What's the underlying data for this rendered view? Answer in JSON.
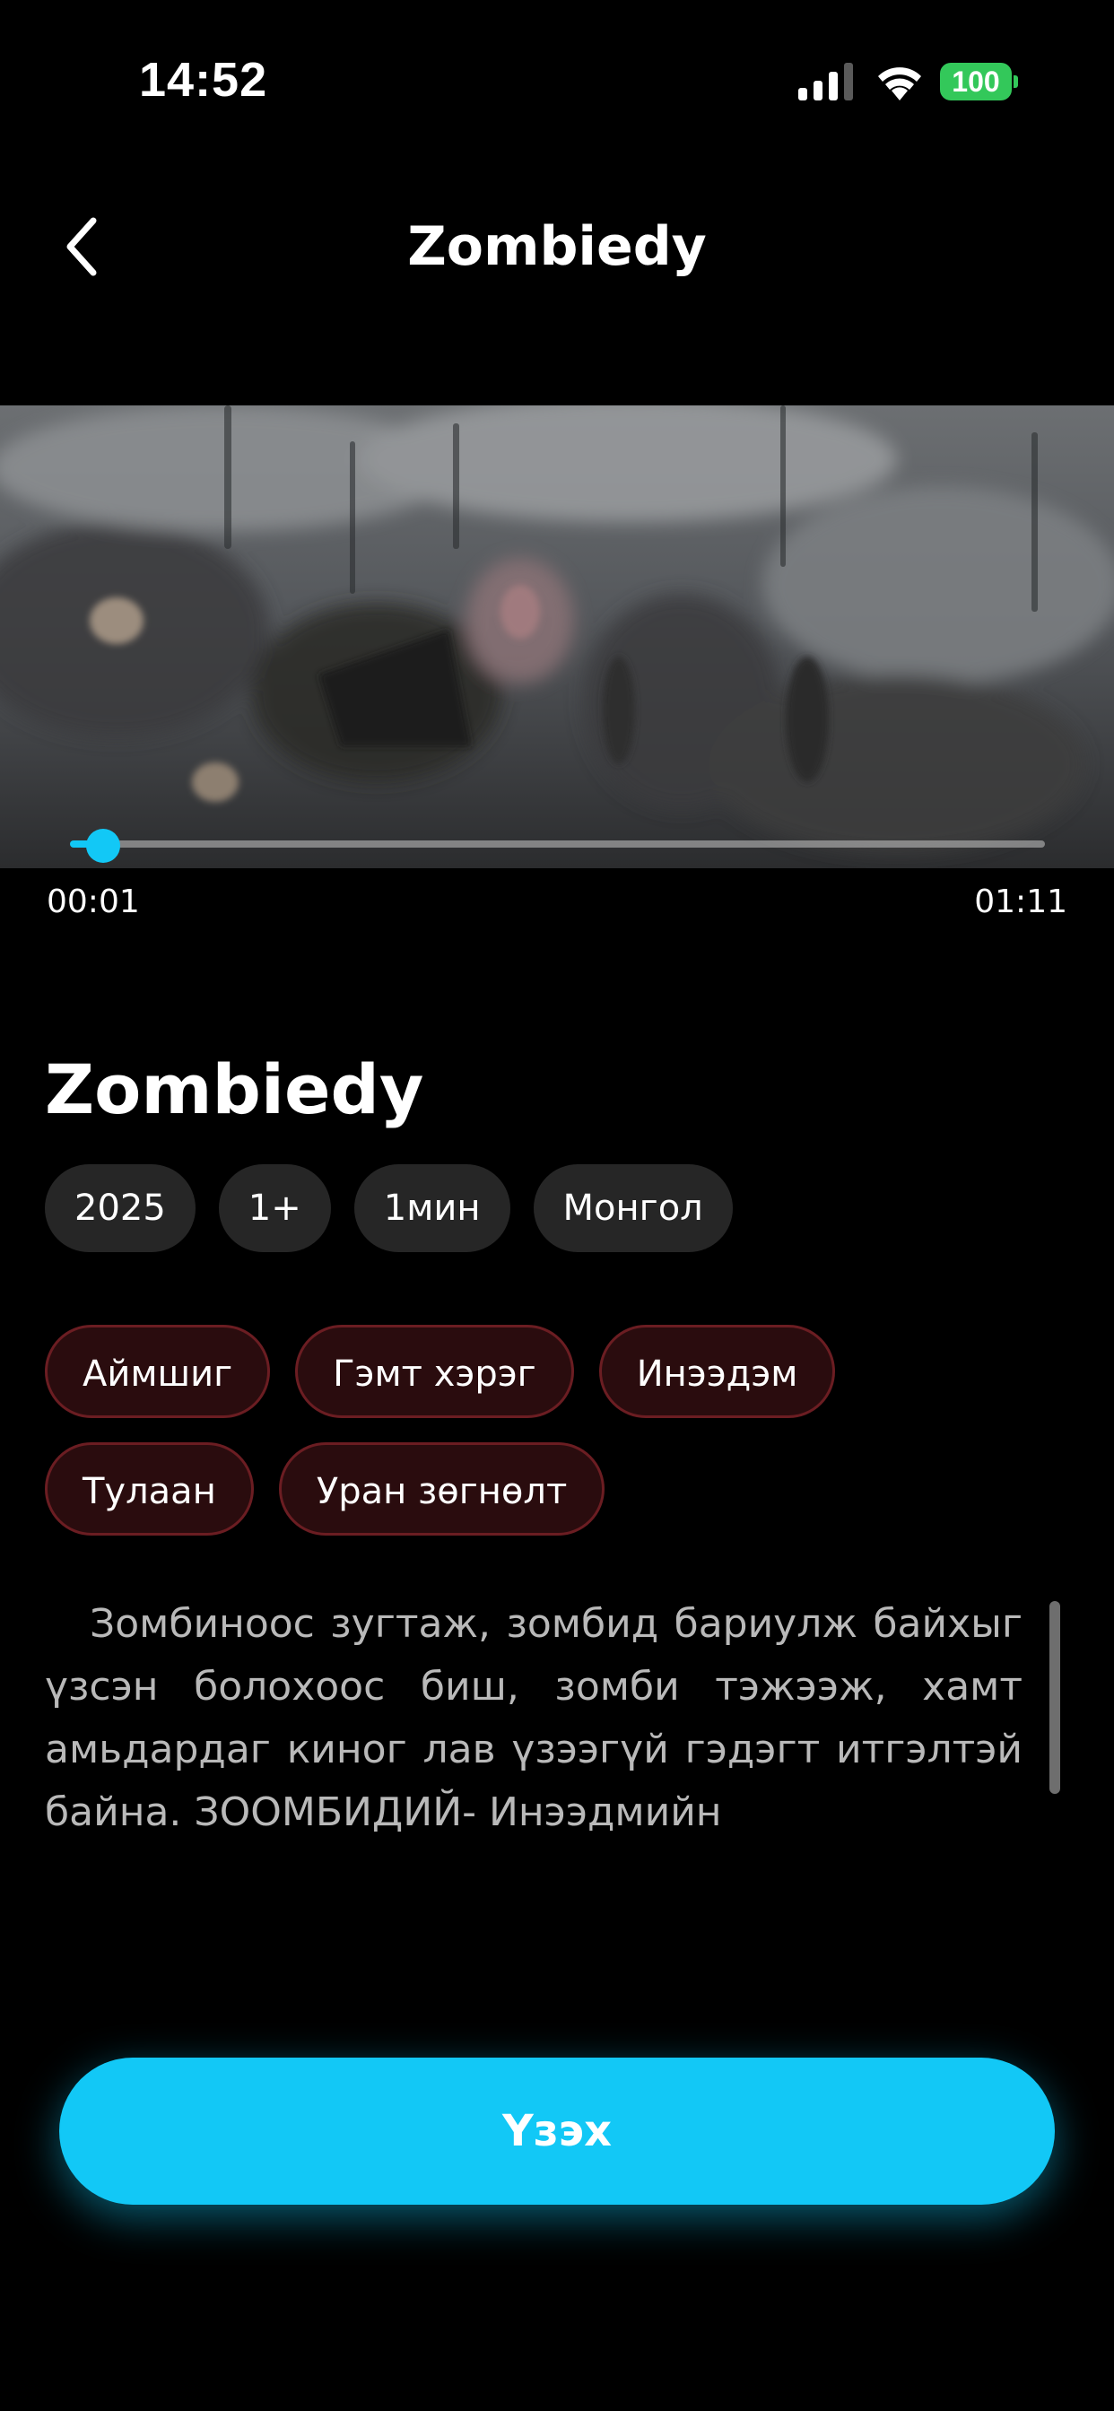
{
  "status_bar": {
    "time": "14:52",
    "battery_level": "100",
    "battery_color": "#33c85a",
    "icons": [
      "signal-icon",
      "wifi-icon",
      "battery-icon"
    ]
  },
  "header": {
    "back_icon": "chevron-left-icon",
    "title": "Zombiedy"
  },
  "player": {
    "current_time": "00:01",
    "total_time": "01:11",
    "progress_fraction": 0.014,
    "accent_color": "#12c8f6"
  },
  "movie": {
    "title": "Zombiedy",
    "meta": [
      "2025",
      "1+",
      "1мин",
      "Монгол"
    ],
    "genres": [
      "Аймшиг",
      "Гэмт хэрэг",
      "Инээдэм",
      "Тулаан",
      "Уран зөгнөлт"
    ],
    "description": "Зомбиноос зугтаж, зомбид бариулж байхыг үзсэн болохоос биш, зомби тэжээж, хамт амьдардаг киног лав үзээгүй гэдэгт итгэлтэй байна. ЗООМБИДИЙ- Инээдмийн"
  },
  "cta": {
    "watch_label": "Үзэх"
  }
}
